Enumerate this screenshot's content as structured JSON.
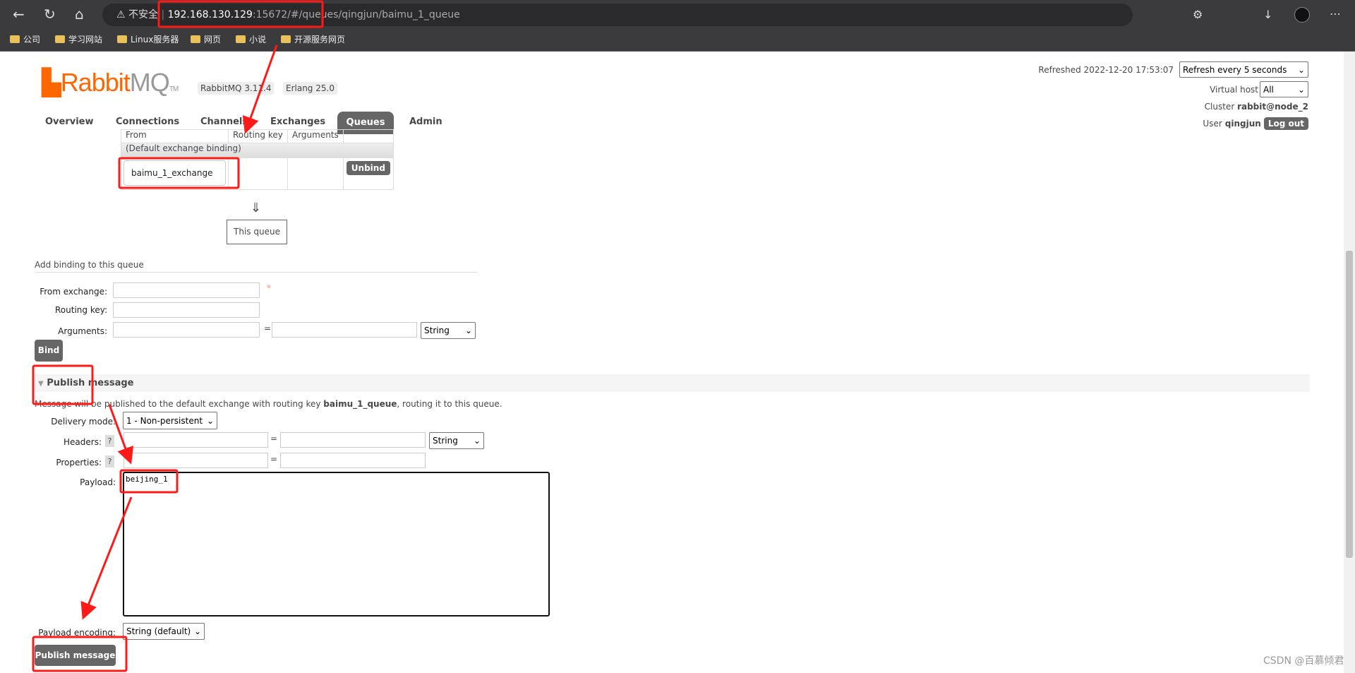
{
  "browser": {
    "security": "不安全",
    "url_host": "192.168.130.129",
    "url_rest": ":15672/#/queues/qingjun/baimu_1_queue",
    "bookmarks": [
      "公司",
      "学习网站",
      "Linux服务器",
      "网页",
      "小说",
      "开源服务网页"
    ]
  },
  "header": {
    "logo": "RabbitMQ",
    "version": "RabbitMQ 3.11.4",
    "erlang": "Erlang 25.0",
    "refreshed": "Refreshed 2022-12-20 17:53:07",
    "refresh_select": "Refresh every 5 seconds",
    "vhost_label": "Virtual host",
    "vhost": "All",
    "cluster_label": "Cluster",
    "cluster": "rabbit@node_2",
    "user_label": "User",
    "user": "qingjun",
    "logout": "Log out"
  },
  "nav": [
    "Overview",
    "Connections",
    "Channels",
    "Exchanges",
    "Queues",
    "Admin"
  ],
  "bindings": {
    "headers": [
      "From",
      "Routing key",
      "Arguments"
    ],
    "default_row": "(Default exchange binding)",
    "exchange": "baimu_1_exchange",
    "unbind": "Unbind",
    "arrow": "⇓",
    "this_queue": "This queue"
  },
  "add_binding": {
    "title": "Add binding to this queue",
    "from_exchange": "From exchange:",
    "required": "*",
    "routing_key": "Routing key:",
    "arguments": "Arguments:",
    "eq": "=",
    "type": "String",
    "bind": "Bind"
  },
  "publish": {
    "title": "Publish message",
    "note_pre": "Message will be published to the default exchange with routing key ",
    "note_key": "baimu_1_queue",
    "note_post": ", routing it to this queue.",
    "delivery_label": "Delivery mode:",
    "delivery": "1 - Non-persistent",
    "headers_label": "Headers:",
    "properties_label": "Properties:",
    "help": "?",
    "eq": "=",
    "type": "String",
    "payload_label": "Payload:",
    "payload": "beijing_1",
    "encoding_label": "Payload encoding:",
    "encoding": "String (default)",
    "button": "Publish message"
  },
  "watermark": "CSDN @百慕倾君",
  "annotation_color": "#ff1a1a"
}
